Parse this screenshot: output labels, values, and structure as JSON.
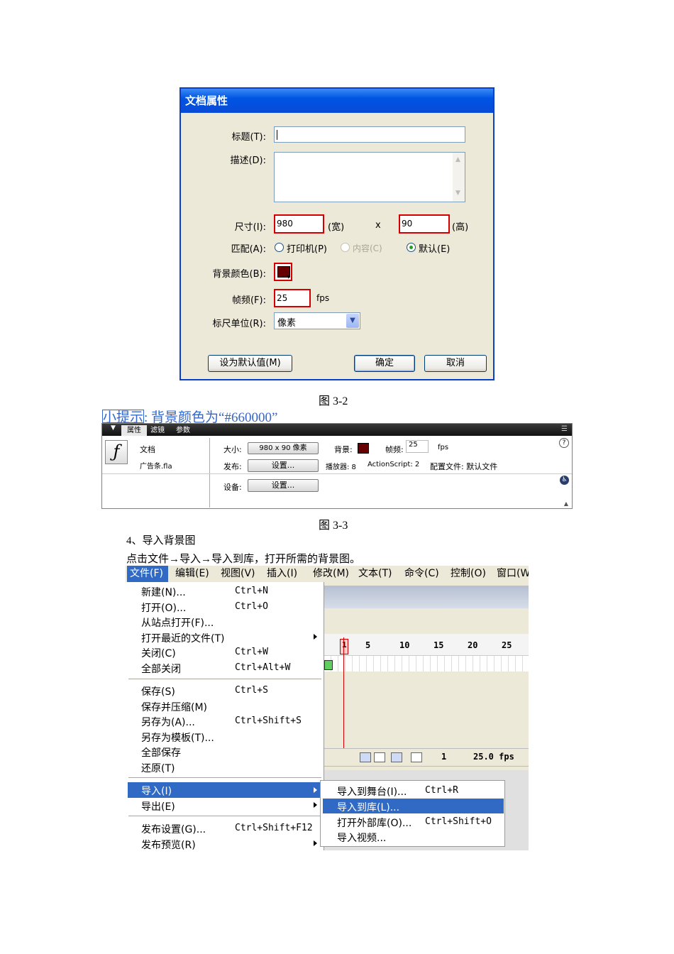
{
  "dialog": {
    "title": "文档属性",
    "labels": {
      "title": "标题(T):",
      "desc": "描述(D):",
      "size": "尺寸(I):",
      "match": "匹配(A):",
      "bg": "背景颜色(B):",
      "fps": "帧频(F):",
      "ruler": "标尺单位(R):"
    },
    "width": "980",
    "width_unit": "(宽)",
    "x": "x",
    "height": "90",
    "height_unit": "(高)",
    "match_options": [
      "打印机(P)",
      "内容(C)",
      "默认(E)"
    ],
    "fps": "25",
    "fps_unit": "fps",
    "ruler_unit": "像素",
    "buttons": {
      "set_default": "设为默认值(M)",
      "ok": "确定",
      "cancel": "取消"
    },
    "bg_color": "#660000"
  },
  "caption1": "图 3-2",
  "tip": {
    "link": "小提示",
    "colon": ":",
    "text": " 背景颜色为“#660000”"
  },
  "panel": {
    "tabs": [
      "属性",
      "滤镜",
      "参数"
    ],
    "doc": "文档",
    "filename": "广告条.fla",
    "size_label": "大小:",
    "size_value": "980 x 90 像素",
    "bg_label": "背景:",
    "fps_label": "帧频:",
    "fps_value": "25",
    "fps_unit": "fps",
    "publish_label": "发布:",
    "settings_btn": "设置...",
    "player": "播放器: 8",
    "actionscript": "ActionScript: 2",
    "profile": "配置文件: 默认文件",
    "device_label": "设备:",
    "device_btn": "设置..."
  },
  "caption2": "图 3-3",
  "step": "4、导入背景图",
  "instruction": "点击文件→导入→导入到库，打开所需的背景图。",
  "menubar": [
    "文件(F)",
    "编辑(E)",
    "视图(V)",
    "插入(I)",
    "修改(M)",
    "文本(T)",
    "命令(C)",
    "控制(O)",
    "窗口(W"
  ],
  "menu": [
    {
      "label": "新建(N)...",
      "shortcut": "Ctrl+N"
    },
    {
      "label": "打开(O)...",
      "shortcut": "Ctrl+O"
    },
    {
      "label": "从站点打开(F)...",
      "shortcut": ""
    },
    {
      "label": "打开最近的文件(T)",
      "shortcut": ""
    },
    {
      "label": "关闭(C)",
      "shortcut": "Ctrl+W"
    },
    {
      "label": "全部关闭",
      "shortcut": "Ctrl+Alt+W"
    },
    {
      "label": "保存(S)",
      "shortcut": "Ctrl+S"
    },
    {
      "label": "保存并压缩(M)",
      "shortcut": ""
    },
    {
      "label": "另存为(A)...",
      "shortcut": "Ctrl+Shift+S"
    },
    {
      "label": "另存为模板(T)...",
      "shortcut": ""
    },
    {
      "label": "全部保存",
      "shortcut": ""
    },
    {
      "label": "还原(T)",
      "shortcut": ""
    },
    {
      "label": "导入(I)",
      "shortcut": ""
    },
    {
      "label": "导出(E)",
      "shortcut": ""
    },
    {
      "label": "发布设置(G)...",
      "shortcut": "Ctrl+Shift+F12"
    },
    {
      "label": "发布预览(R)",
      "shortcut": ""
    }
  ],
  "submenu": [
    {
      "label": "导入到舞台(I)...",
      "shortcut": "Ctrl+R"
    },
    {
      "label": "导入到库(L)...",
      "shortcut": ""
    },
    {
      "label": "打开外部库(O)...",
      "shortcut": "Ctrl+Shift+O"
    },
    {
      "label": "导入视频...",
      "shortcut": ""
    }
  ],
  "timeline": {
    "frames": [
      "1",
      "5",
      "10",
      "15",
      "20",
      "25"
    ],
    "current_frame": "1",
    "fps": "25.0 fps"
  }
}
